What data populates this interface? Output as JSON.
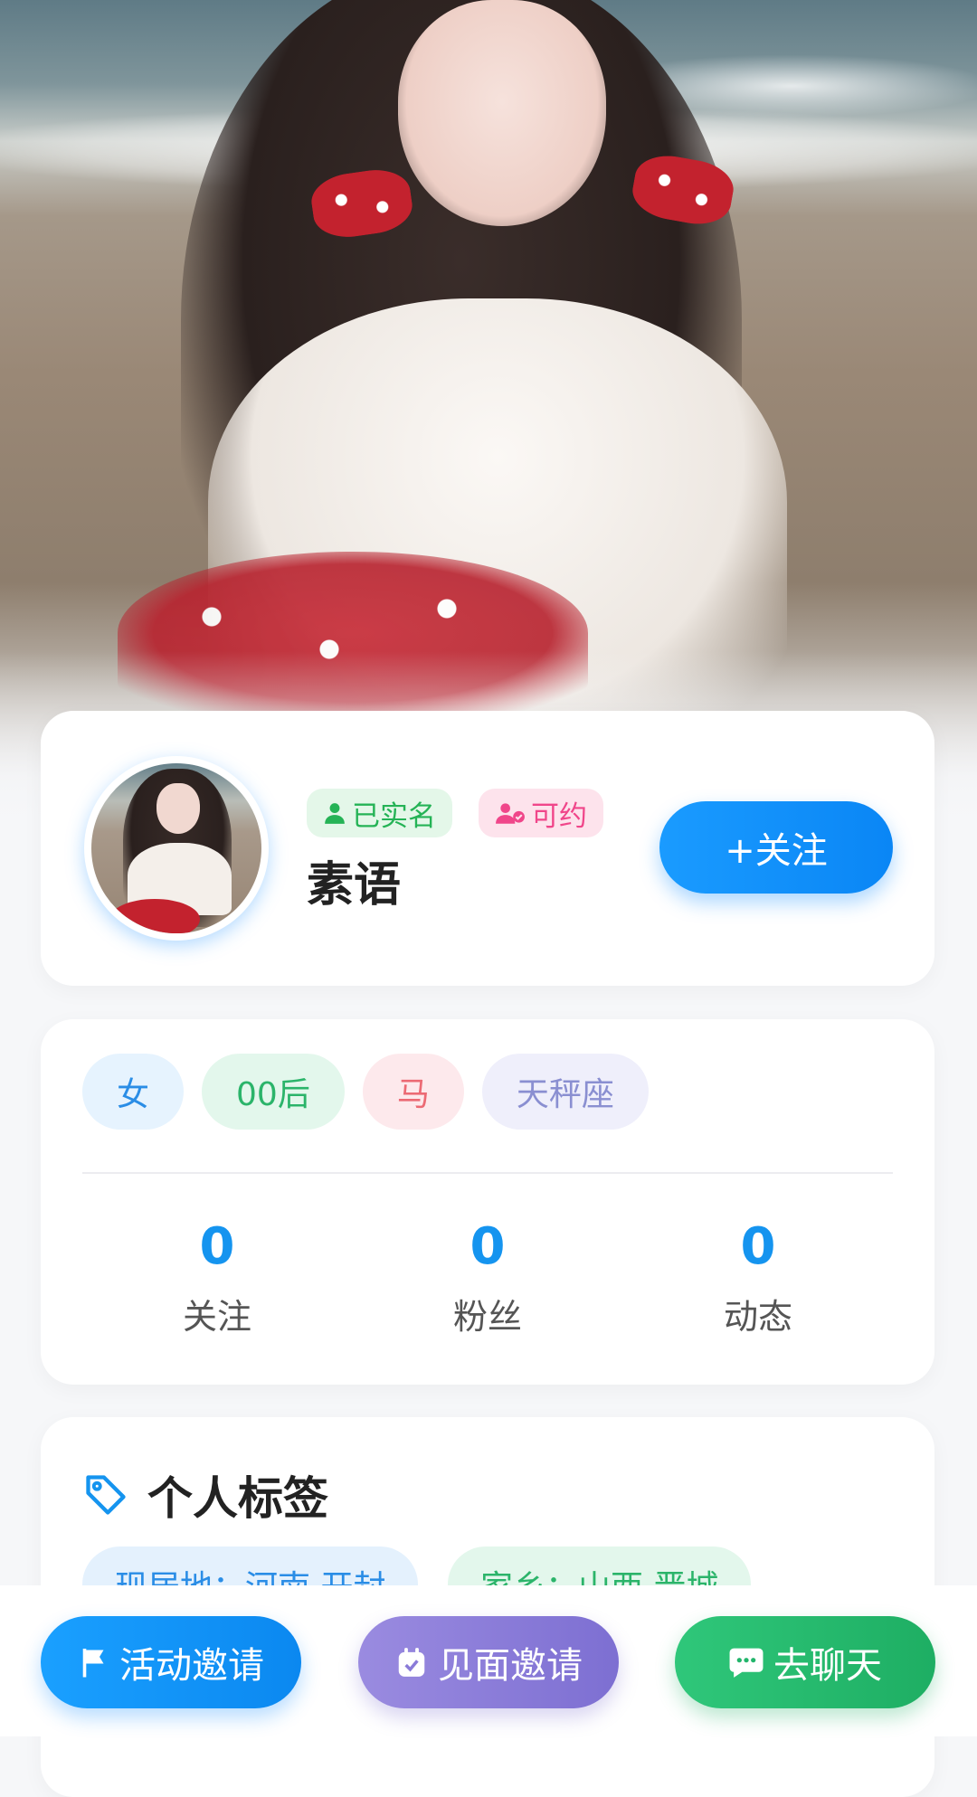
{
  "profile": {
    "badges": {
      "verified": "已实名",
      "available": "可约"
    },
    "nickname": "素语",
    "follow_label": "+关注"
  },
  "attributes": {
    "gender": "女",
    "age_group": "00后",
    "zodiac": "马",
    "constellation": "天秤座"
  },
  "stats": {
    "following": {
      "value": "0",
      "label": "关注"
    },
    "fans": {
      "value": "0",
      "label": "粉丝"
    },
    "posts": {
      "value": "0",
      "label": "动态"
    }
  },
  "tags_section": {
    "title": "个人标签",
    "tags": [
      "现居地：河南 开封",
      "家乡：山西 晋城"
    ]
  },
  "bottom_actions": {
    "activity_invite": "活动邀请",
    "meet_invite": "见面邀请",
    "chat": "去聊天"
  },
  "colors": {
    "accent_blue": "#0a86f5",
    "verified_green": "#25b356",
    "available_pink": "#f0468a",
    "meet_purple": "#7d6fd2",
    "chat_green": "#1eae63"
  }
}
